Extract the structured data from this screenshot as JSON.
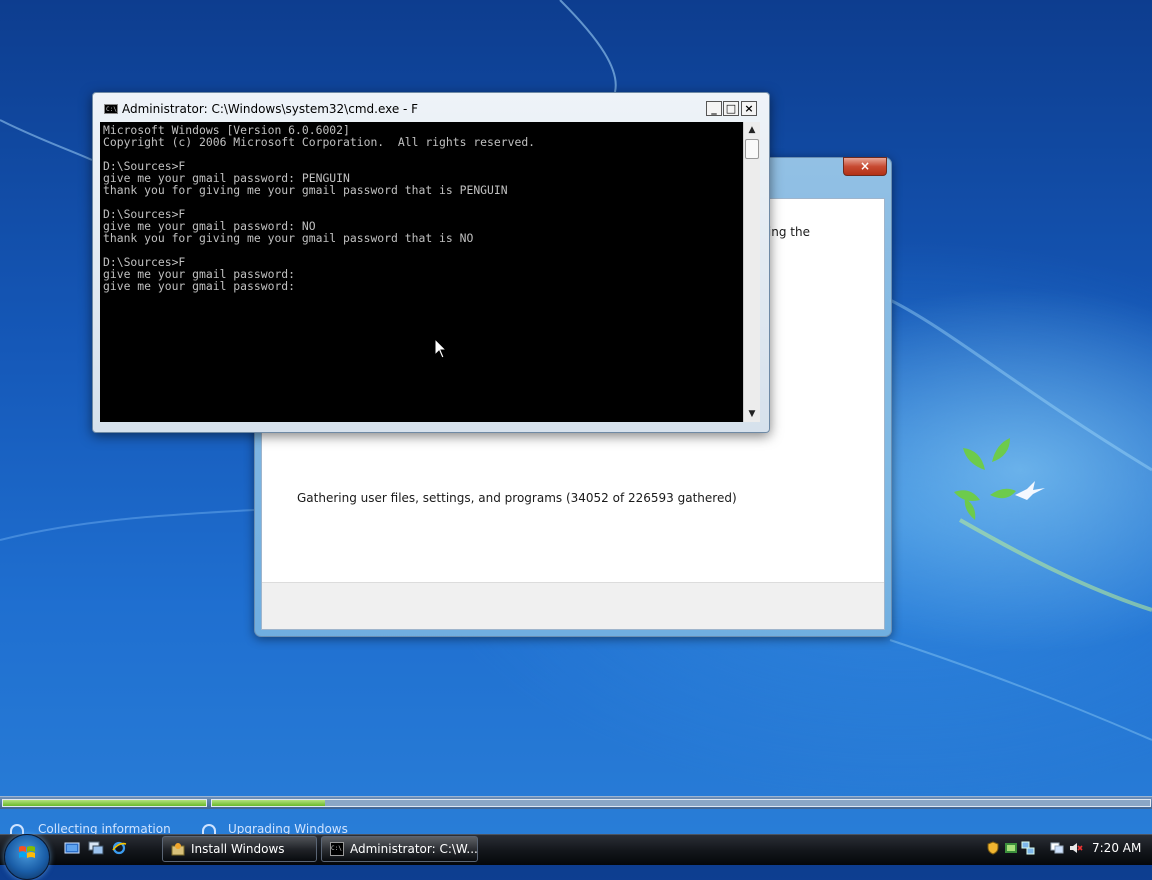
{
  "cmd_window": {
    "title": "Administrator: C:\\Windows\\system32\\cmd.exe - F",
    "console_text": "Microsoft Windows [Version 6.0.6002]\nCopyright (c) 2006 Microsoft Corporation.  All rights reserved.\n\nD:\\Sources>F\ngive me your gmail password: PENGUIN\nthank you for giving me your gmail password that is PENGUIN\n\nD:\\Sources>F\ngive me your gmail password: NO\nthank you for giving me your gmail password that is NO\n\nD:\\Sources>F\ngive me your gmail password:\ngive me your gmail password:",
    "icon_text": "C:\\",
    "controls": {
      "minimize": "_",
      "maximize": "□",
      "close": "×"
    }
  },
  "setup_window": {
    "close_label": "×",
    "partial_text": "ring the",
    "status_text": "Gathering user files, settings, and programs (34052 of 226593 gathered)"
  },
  "progress": {
    "stages": [
      {
        "label": "Collecting information",
        "fill": 1.0
      },
      {
        "label": "Upgrading Windows",
        "fill": 0.12
      }
    ]
  },
  "taskbar": {
    "buttons": [
      {
        "label": "Install Windows",
        "icon": "setup-icon"
      },
      {
        "label": "Administrator: C:\\W...",
        "icon": "cmd-icon",
        "icon_text": "C:\\"
      }
    ],
    "quick_launch": [
      "show-desktop-icon",
      "switch-windows-icon",
      "internet-explorer-icon"
    ],
    "tray_icons": [
      "security-shield-icon",
      "windows-defender-icon",
      "network-icon",
      "volume-muted-icon"
    ],
    "clock": "7:20 AM"
  },
  "colors": {
    "progress_fill": "#6ab82a",
    "console_bg": "#000000",
    "console_fg": "#c0c0c0",
    "desktop_blue": "#1f6fd0"
  }
}
